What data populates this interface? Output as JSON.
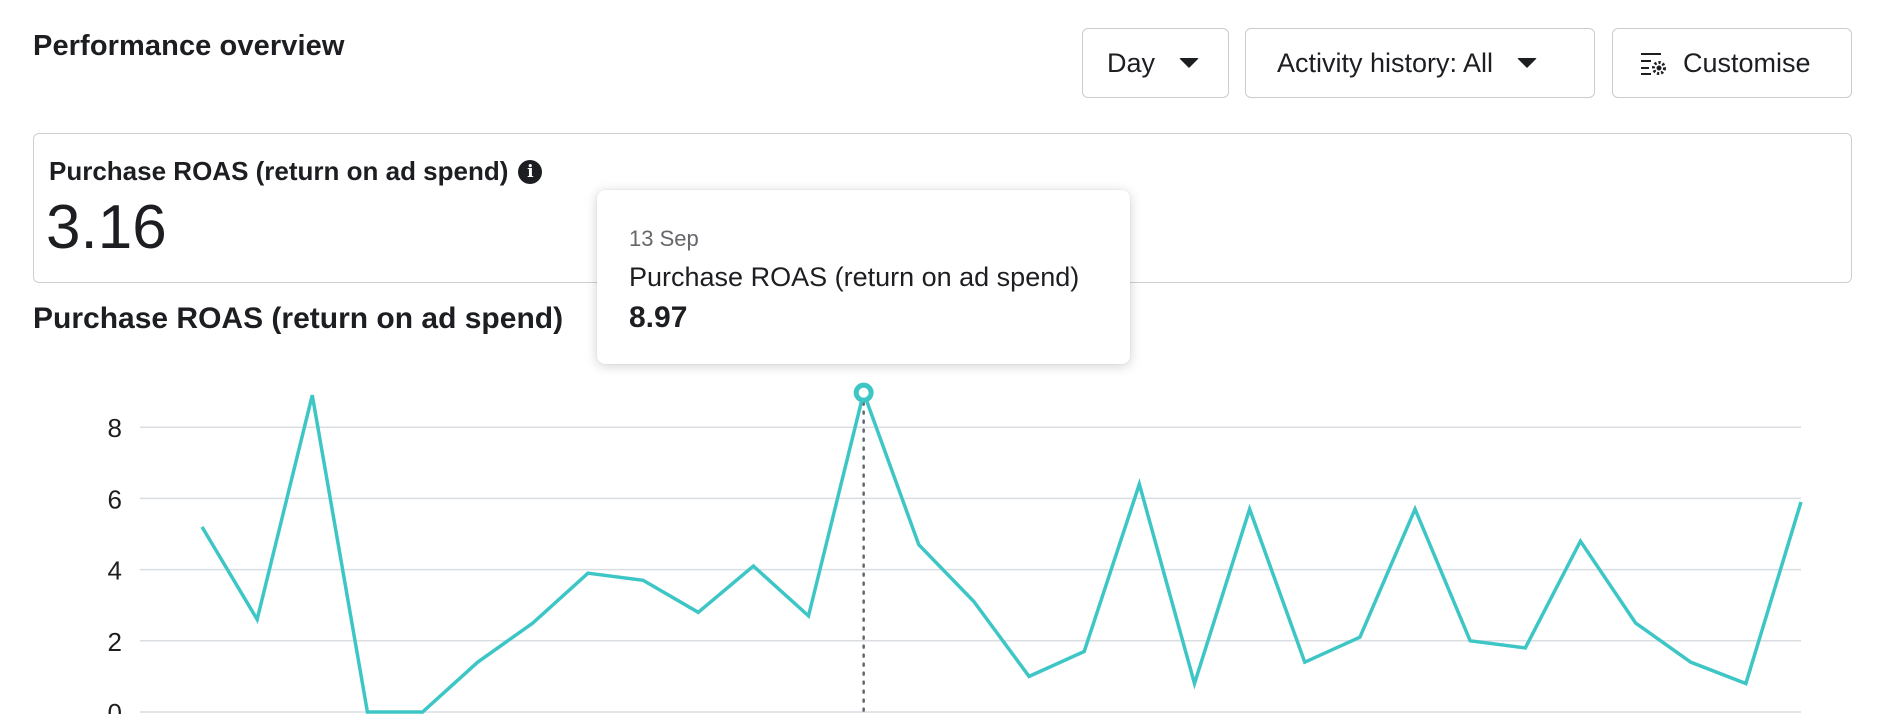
{
  "header": {
    "title": "Performance overview",
    "day_button": "Day",
    "activity_button": "Activity history: All",
    "customise_button": "Customise"
  },
  "metric_card": {
    "label": "Purchase ROAS (return on ad spend)",
    "value": "3.16"
  },
  "chart_section": {
    "title": "Purchase ROAS (return on ad spend)"
  },
  "tooltip": {
    "date": "13 Sep",
    "label": "Purchase ROAS (return on ad spend)",
    "value": "8.97"
  },
  "colors": {
    "series": "#3ec6c6",
    "grid": "#dadde1",
    "text": "#1c1e21"
  },
  "chart_data": {
    "type": "line",
    "title": "Purchase ROAS (return on ad spend)",
    "xlabel": "",
    "ylabel": "",
    "ylim": [
      0,
      9
    ],
    "yticks": [
      0,
      2,
      4,
      6,
      8
    ],
    "grid": true,
    "series": [
      {
        "values": [
          5.2,
          2.6,
          8.9,
          0.0,
          0.0,
          1.4,
          2.5,
          3.9,
          3.7,
          2.8,
          4.1,
          2.7,
          8.97,
          4.7,
          3.1,
          1.0,
          1.7,
          6.4,
          0.8,
          5.7,
          1.4,
          2.1,
          5.7,
          2.0,
          1.8,
          4.8,
          2.5,
          1.4,
          0.8,
          5.9
        ]
      }
    ],
    "highlight_index": 12
  }
}
